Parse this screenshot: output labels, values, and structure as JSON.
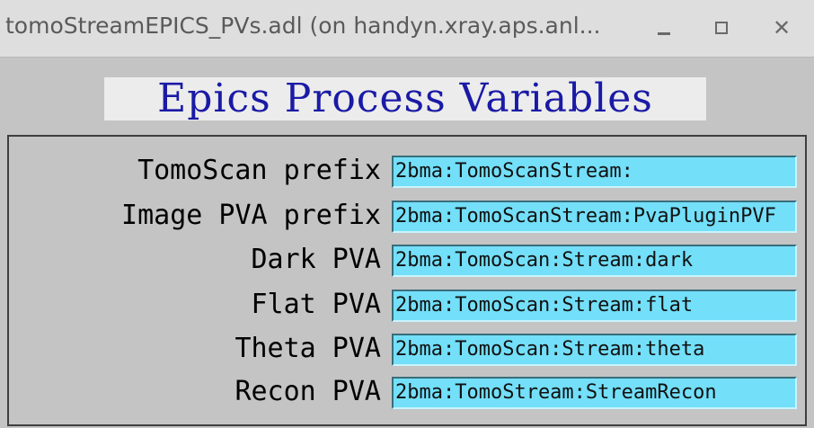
{
  "window": {
    "title": "tomoStreamEPICS_PVs.adl (on handyn.xray.aps.anl...",
    "buttons": [
      "minimize",
      "maximize",
      "close"
    ],
    "close_glyph": "✕"
  },
  "panel": {
    "heading": "Epics Process Variables",
    "rows": [
      {
        "label": "TomoScan prefix",
        "value": "2bma:TomoScanStream:"
      },
      {
        "label": "Image PVA prefix",
        "value": "2bma:TomoScanStream:PvaPluginPVF"
      },
      {
        "label": "Dark PVA",
        "value": "2bma:TomoScan:Stream:dark"
      },
      {
        "label": "Flat PVA",
        "value": "2bma:TomoScan:Stream:flat"
      },
      {
        "label": "Theta PVA",
        "value": "2bma:TomoScan:Stream:theta"
      },
      {
        "label": "Recon PVA",
        "value": "2bma:TomoStream:StreamRecon"
      }
    ]
  },
  "colors": {
    "background": "#c4c4c4",
    "heading_text": "#1a1aa6",
    "heading_bg": "#ececec",
    "field_bg": "#73dff9"
  },
  "icons": [
    "minimize-icon",
    "maximize-icon",
    "close-icon"
  ]
}
